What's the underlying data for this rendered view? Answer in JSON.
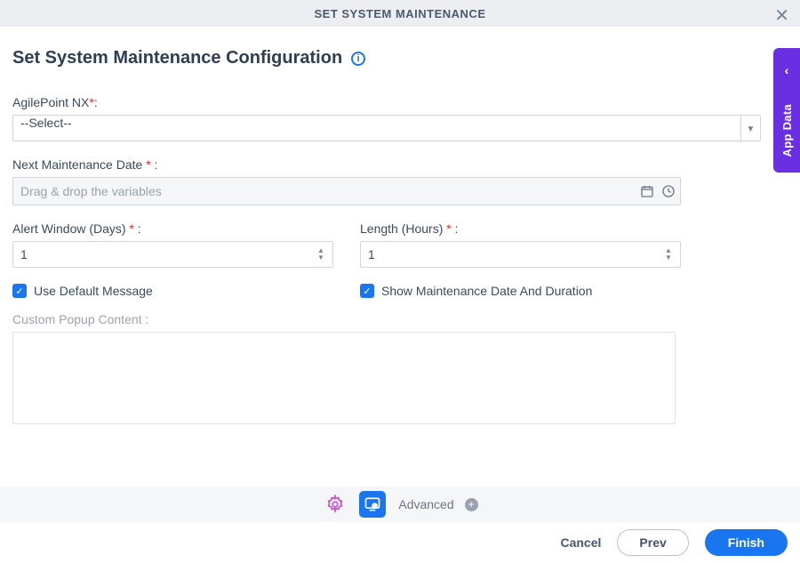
{
  "header": {
    "title": "SET SYSTEM MAINTENANCE"
  },
  "page": {
    "heading": "Set System Maintenance Configuration"
  },
  "fields": {
    "agilepoint": {
      "label": "AgilePoint NX",
      "colon": ":",
      "selected": "--Select--"
    },
    "nextDate": {
      "label": "Next Maintenance Date ",
      "colon": " :",
      "placeholder": "Drag & drop the variables"
    },
    "alertWindow": {
      "label": "Alert Window (Days) ",
      "colon": " :",
      "value": "1"
    },
    "length": {
      "label": "Length (Hours) ",
      "colon": " :",
      "value": "1"
    },
    "useDefault": {
      "label": "Use Default Message"
    },
    "showDuration": {
      "label": "Show Maintenance Date And Duration"
    },
    "customPopup": {
      "label": "Custom Popup Content :"
    }
  },
  "stepper": {
    "advanced": "Advanced"
  },
  "footer": {
    "cancel": "Cancel",
    "prev": "Prev",
    "finish": "Finish"
  },
  "sideTab": {
    "label": "App Data",
    "arrow": "‹"
  },
  "req": "*"
}
